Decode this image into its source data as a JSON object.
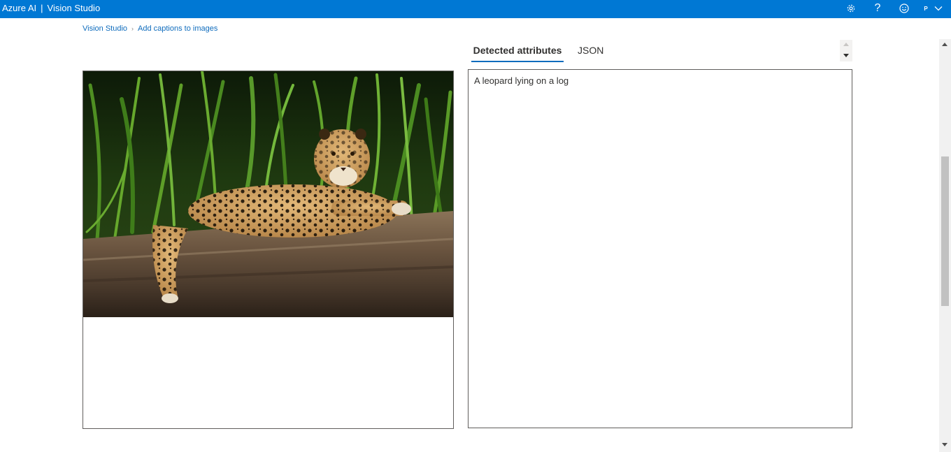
{
  "header": {
    "brand": "Azure AI",
    "separator": "|",
    "product": "Vision Studio",
    "icons": [
      "gear-icon",
      "help-icon",
      "feedback-smiley-icon",
      "user-avatar",
      "chevron-down-icon"
    ],
    "help_glyph": "?",
    "user_initial": "P",
    "background_color": "#0078d4"
  },
  "breadcrumb": {
    "items": [
      "Vision Studio",
      "Add captions to images"
    ],
    "separator": "›"
  },
  "image_panel": {
    "image_subject": "leopard-lying-on-log-photo"
  },
  "tabs": [
    {
      "label": "Detected attributes",
      "selected": true
    },
    {
      "label": "JSON",
      "selected": false
    }
  ],
  "result": {
    "caption": "A leopard lying on a log"
  },
  "colors": {
    "accent": "#0f6cbd",
    "border": "#605e5c"
  }
}
